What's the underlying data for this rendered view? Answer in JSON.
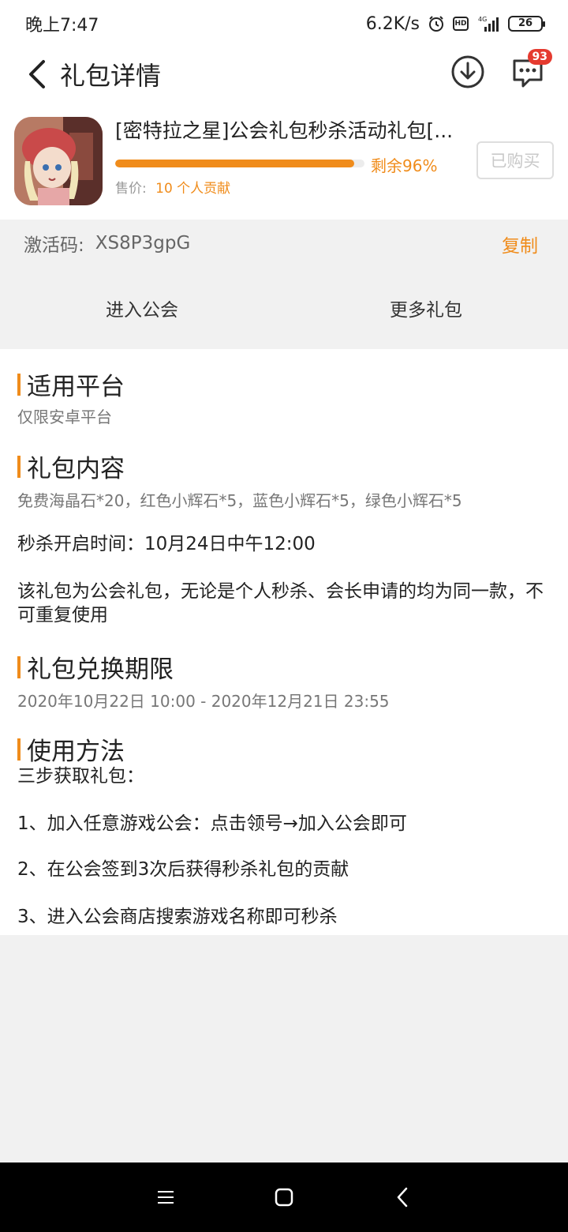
{
  "status_bar": {
    "time": "晚上7:47",
    "network_speed": "6.2K/s",
    "network_type": "4G",
    "battery": "26"
  },
  "header": {
    "title": "礼包详情",
    "message_badge": "93"
  },
  "gift": {
    "name": "[密特拉之星]公会礼包秒杀活动礼包[...",
    "progress_fraction": 0.96,
    "remain_text": "剩余96%",
    "price_label": "售价:",
    "price_value": "10 个人贡献",
    "status_button": "已购买"
  },
  "activation": {
    "label": "激活码:",
    "code": "XS8P3gpG",
    "copy_label": "复制"
  },
  "actions": {
    "enter_guild": "进入公会",
    "more_gifts": "更多礼包"
  },
  "sections": {
    "platform": {
      "title": "适用平台",
      "text": "仅限安卓平台"
    },
    "contents": {
      "title": "礼包内容",
      "items": "免费海晶石*20，红色小辉石*5，蓝色小辉石*5，绿色小辉石*5",
      "time_note": "秒杀开启时间：10月24日中午12:00",
      "note": "该礼包为公会礼包，无论是个人秒杀、会长申请的均为同一款，不可重复使用"
    },
    "validity": {
      "title": "礼包兑换期限",
      "period": "2020年10月22日 10:00 - 2020年12月21日 23:55"
    },
    "usage": {
      "title": "使用方法",
      "intro": "三步获取礼包：",
      "step1": "1、加入任意游戏公会：点击领号→加入公会即可",
      "step2": "2、在公会签到3次后获得秒杀礼包的贡献",
      "step3": "3、进入公会商店搜索游戏名称即可秒杀"
    }
  },
  "colors": {
    "accent": "#f08c1b",
    "badge": "#e53a2f"
  }
}
